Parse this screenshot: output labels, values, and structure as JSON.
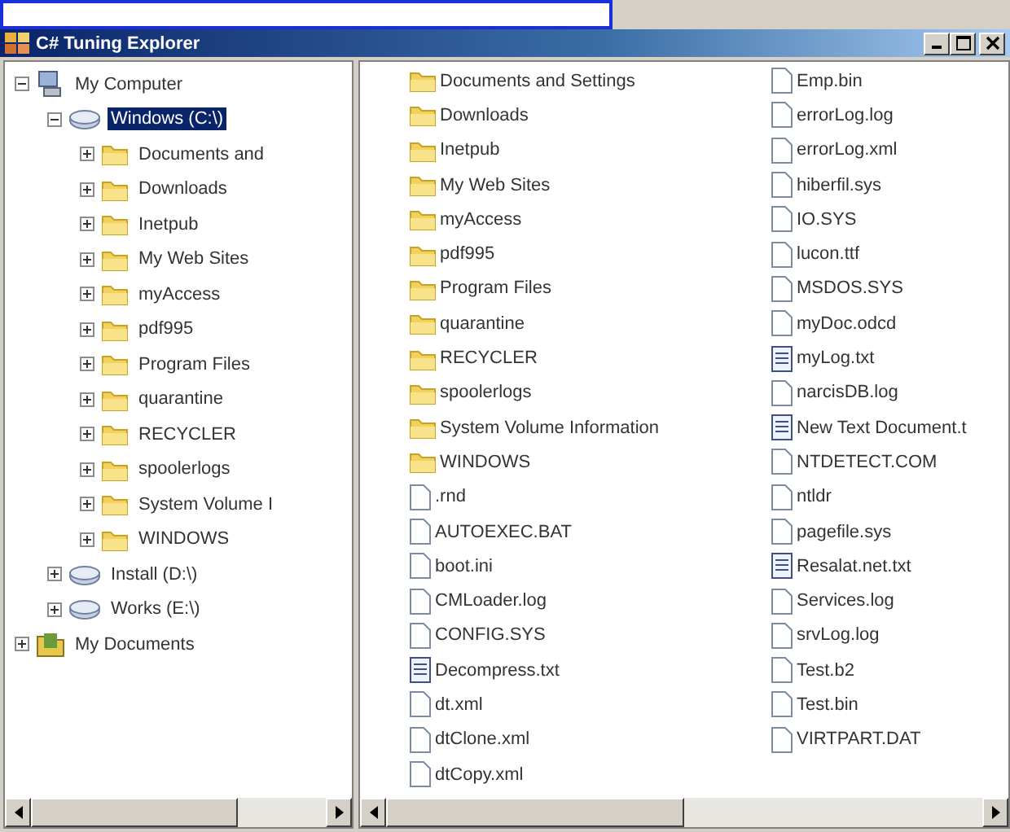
{
  "window": {
    "title": "C# Tuning Explorer"
  },
  "tree": [
    {
      "label": "My Computer",
      "kind": "computer",
      "expanded": true,
      "selected": false,
      "children": [
        {
          "label": "Windows (C:\\)",
          "kind": "drive",
          "expanded": true,
          "selected": true,
          "children": [
            {
              "label": "Documents and",
              "kind": "folder",
              "expanded": false,
              "selected": false
            },
            {
              "label": "Downloads",
              "kind": "folder",
              "expanded": false,
              "selected": false
            },
            {
              "label": "Inetpub",
              "kind": "folder",
              "expanded": false,
              "selected": false
            },
            {
              "label": "My Web Sites",
              "kind": "folder",
              "expanded": false,
              "selected": false
            },
            {
              "label": "myAccess",
              "kind": "folder",
              "expanded": false,
              "selected": false
            },
            {
              "label": "pdf995",
              "kind": "folder",
              "expanded": false,
              "selected": false
            },
            {
              "label": "Program Files",
              "kind": "folder",
              "expanded": false,
              "selected": false
            },
            {
              "label": "quarantine",
              "kind": "folder",
              "expanded": false,
              "selected": false
            },
            {
              "label": "RECYCLER",
              "kind": "folder",
              "expanded": false,
              "selected": false
            },
            {
              "label": "spoolerlogs",
              "kind": "folder",
              "expanded": false,
              "selected": false
            },
            {
              "label": "System Volume I",
              "kind": "folder",
              "expanded": false,
              "selected": false
            },
            {
              "label": "WINDOWS",
              "kind": "folder",
              "expanded": false,
              "selected": false
            }
          ]
        },
        {
          "label": "Install (D:\\)",
          "kind": "drive",
          "expanded": false,
          "selected": false
        },
        {
          "label": "Works (E:\\)",
          "kind": "drive",
          "expanded": false,
          "selected": false
        }
      ]
    },
    {
      "label": "My Documents",
      "kind": "documents",
      "expanded": false,
      "selected": false
    }
  ],
  "files": [
    {
      "name": "Documents and Settings",
      "kind": "folder"
    },
    {
      "name": "Downloads",
      "kind": "folder"
    },
    {
      "name": "Inetpub",
      "kind": "folder"
    },
    {
      "name": "My Web Sites",
      "kind": "folder"
    },
    {
      "name": "myAccess",
      "kind": "folder"
    },
    {
      "name": "pdf995",
      "kind": "folder"
    },
    {
      "name": "Program Files",
      "kind": "folder"
    },
    {
      "name": "quarantine",
      "kind": "folder"
    },
    {
      "name": "RECYCLER",
      "kind": "folder"
    },
    {
      "name": "spoolerlogs",
      "kind": "folder"
    },
    {
      "name": "System Volume Information",
      "kind": "folder"
    },
    {
      "name": "WINDOWS",
      "kind": "folder"
    },
    {
      "name": ".rnd",
      "kind": "file"
    },
    {
      "name": "AUTOEXEC.BAT",
      "kind": "file"
    },
    {
      "name": "boot.ini",
      "kind": "file"
    },
    {
      "name": "CMLoader.log",
      "kind": "file"
    },
    {
      "name": "CONFIG.SYS",
      "kind": "file"
    },
    {
      "name": "Decompress.txt",
      "kind": "text"
    },
    {
      "name": "dt.xml",
      "kind": "file"
    },
    {
      "name": "dtClone.xml",
      "kind": "file"
    },
    {
      "name": "dtCopy.xml",
      "kind": "file"
    },
    {
      "name": "Emp.bin",
      "kind": "file"
    },
    {
      "name": "errorLog.log",
      "kind": "file"
    },
    {
      "name": "errorLog.xml",
      "kind": "file"
    },
    {
      "name": "hiberfil.sys",
      "kind": "file"
    },
    {
      "name": "IO.SYS",
      "kind": "file"
    },
    {
      "name": "lucon.ttf",
      "kind": "file"
    },
    {
      "name": "MSDOS.SYS",
      "kind": "file"
    },
    {
      "name": "myDoc.odcd",
      "kind": "file"
    },
    {
      "name": "myLog.txt",
      "kind": "text"
    },
    {
      "name": "narcisDB.log",
      "kind": "file"
    },
    {
      "name": "New Text Document.t",
      "kind": "text"
    },
    {
      "name": "NTDETECT.COM",
      "kind": "file"
    },
    {
      "name": "ntldr",
      "kind": "file"
    },
    {
      "name": "pagefile.sys",
      "kind": "file"
    },
    {
      "name": "Resalat.net.txt",
      "kind": "text"
    },
    {
      "name": "Services.log",
      "kind": "file"
    },
    {
      "name": "srvLog.log",
      "kind": "file"
    },
    {
      "name": "Test.b2",
      "kind": "file"
    },
    {
      "name": "Test.bin",
      "kind": "file"
    },
    {
      "name": "VIRTPART.DAT",
      "kind": "file"
    }
  ]
}
